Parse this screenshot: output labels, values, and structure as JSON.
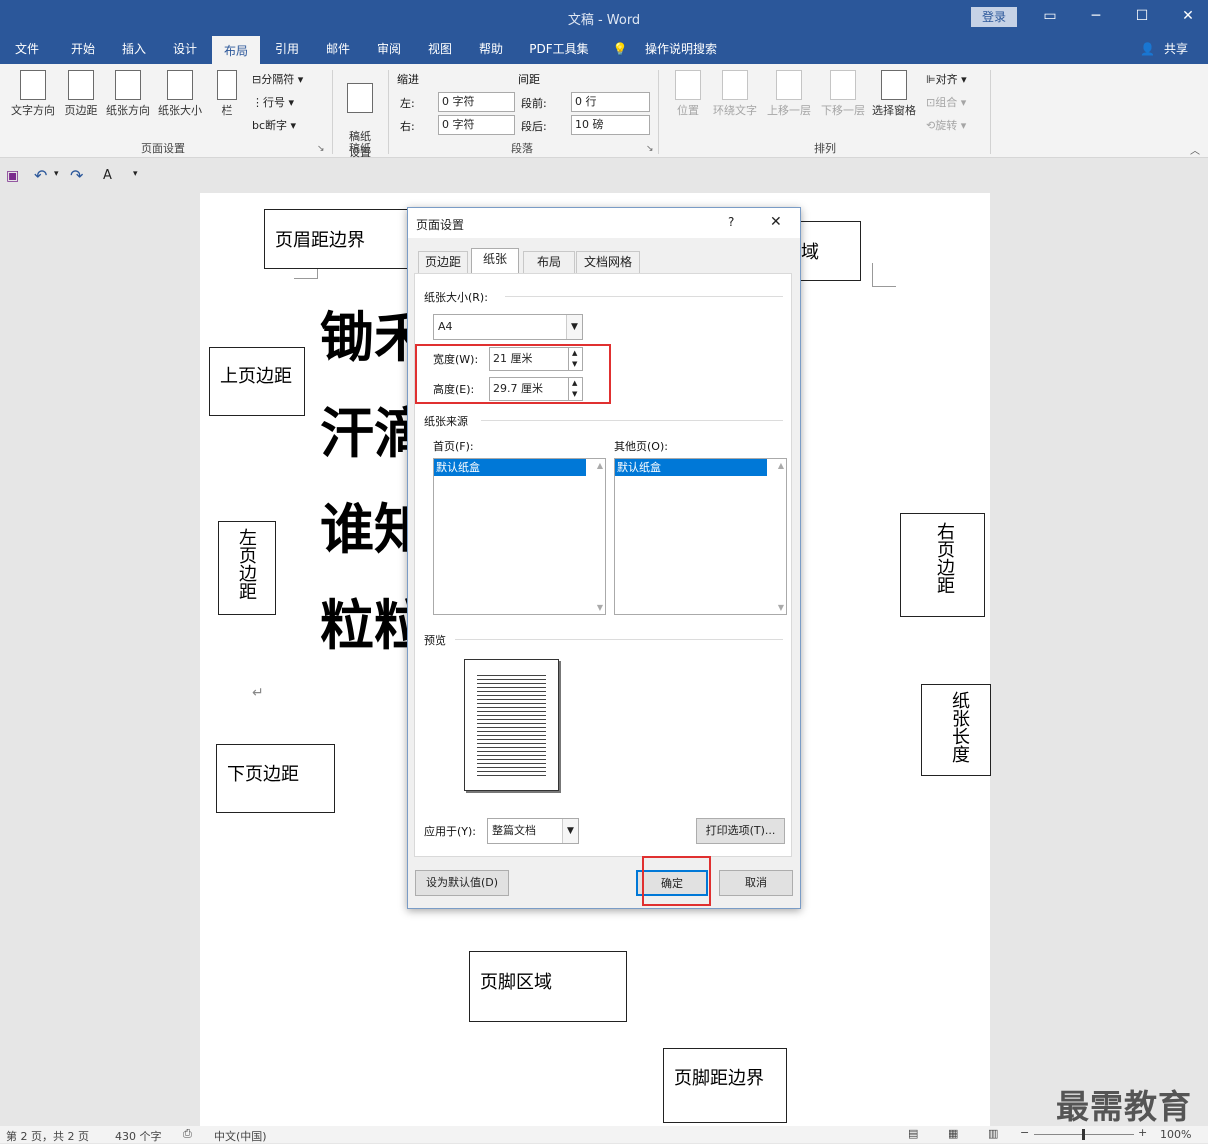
{
  "window": {
    "title": "文稿 - Word",
    "login": "登录",
    "share": "共享"
  },
  "tabs": [
    "文件",
    "开始",
    "插入",
    "设计",
    "布局",
    "引用",
    "邮件",
    "审阅",
    "视图",
    "帮助",
    "PDF工具集",
    "操作说明搜索"
  ],
  "ribbon": {
    "page_setup": {
      "text_dir": "文字方向",
      "margins": "页边距",
      "orientation": "纸张方向",
      "size": "纸张大小",
      "columns": "栏",
      "breaks": "分隔符",
      "line_numbers": "行号",
      "hyphenation": "断字",
      "group": "页面设置"
    },
    "manuscript": {
      "btn": "稿纸\n设置",
      "group": "稿纸"
    },
    "paragraph": {
      "indent": "缩进",
      "spacing": "间距",
      "left": "左:",
      "right": "右:",
      "before": "段前:",
      "after": "段后:",
      "left_val": "0 字符",
      "right_val": "0 字符",
      "before_val": "0 行",
      "after_val": "10 磅",
      "group": "段落"
    },
    "arrange": {
      "position": "位置",
      "wrap": "环绕文字",
      "forward": "上移一层",
      "backward": "下移一层",
      "selection": "选择窗格",
      "align": "对齐",
      "group_btn": "组合",
      "rotate": "旋转",
      "group": "排列"
    }
  },
  "qat": {
    "font_btn": "A"
  },
  "document": {
    "header_margin": "页眉距边界",
    "header_area": "域",
    "top_margin": "上页边距",
    "left_margin": "左页边距",
    "right_margin": "右页边距",
    "paper_length": "纸张长度",
    "bottom_margin": "下页边距",
    "footer_area": "页脚区域",
    "footer_margin": "页脚距边界",
    "lines": [
      "锄禾",
      "汗滴",
      "谁知",
      "粒粒"
    ],
    "mark": "↵"
  },
  "dialog": {
    "title": "页面设置",
    "help": "?",
    "close": "✕",
    "tabs": [
      "页边距",
      "纸张",
      "布局",
      "文档网格"
    ],
    "paper_size_label": "纸张大小(R):",
    "paper_size": "A4",
    "width_label": "宽度(W):",
    "width": "21 厘米",
    "height_label": "高度(E):",
    "height": "29.7 厘米",
    "paper_source": "纸张来源",
    "first_page": "首页(F):",
    "other_pages": "其他页(O):",
    "tray": "默认纸盒",
    "preview": "预览",
    "apply_label": "应用于(Y):",
    "apply": "整篇文档",
    "print_opts": "打印选项(T)...",
    "set_default": "设为默认值(D)",
    "ok": "确定",
    "cancel": "取消"
  },
  "status": {
    "page": "第 2 页，共 2 页",
    "words": "430 个字",
    "lang": "中文(中国)",
    "zoom": "100%"
  },
  "watermark": "最需教育"
}
